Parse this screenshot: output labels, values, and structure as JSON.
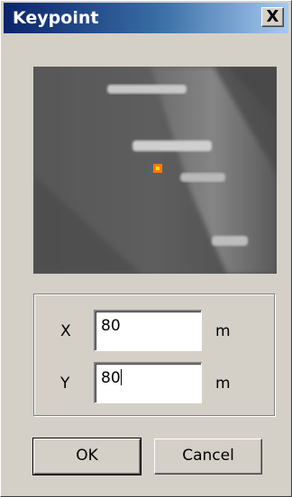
{
  "dialog": {
    "title": "Keypoint",
    "close_label": "X"
  },
  "fields": {
    "x_label": "X",
    "x_value": "80",
    "x_unit": "m",
    "y_label": "Y",
    "y_value": "80",
    "y_unit": "m"
  },
  "buttons": {
    "ok_label": "OK",
    "cancel_label": "Cancel"
  },
  "colors": {
    "title_start": "#0a246a",
    "title_end": "#a6caf0",
    "dialog_bg": "#d4d0c8",
    "keypoint_marker": "#ff6a00"
  }
}
